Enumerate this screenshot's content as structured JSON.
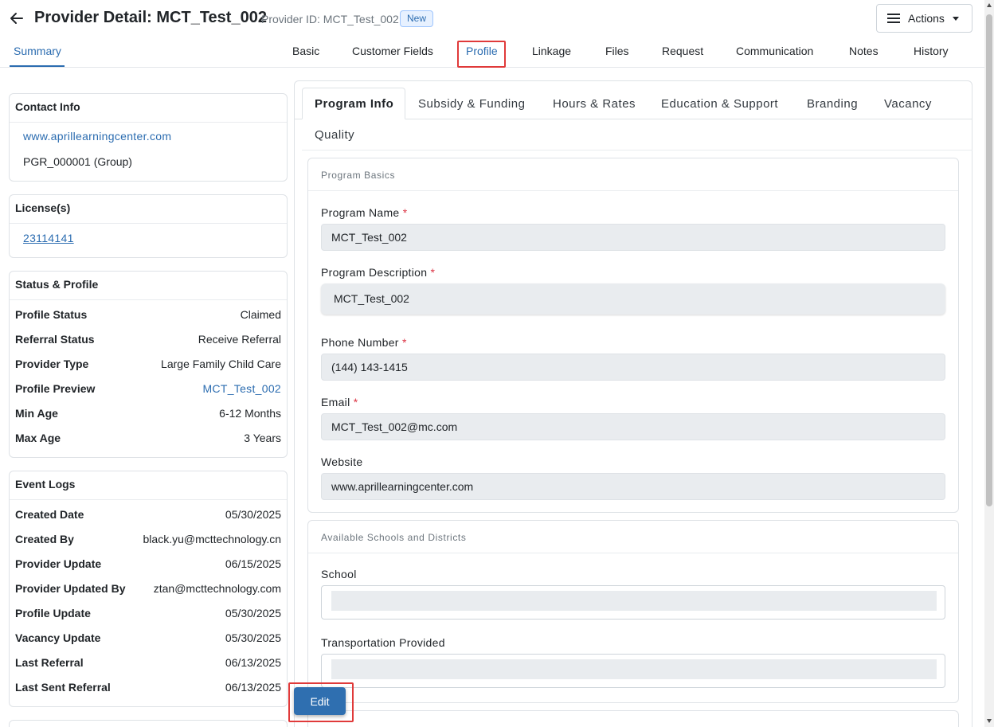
{
  "header": {
    "title": "Provider Detail: MCT_Test_002",
    "provider_id": "Provider ID: MCT_Test_002",
    "badge": "New",
    "actions_label": "Actions"
  },
  "top_tabs": {
    "summary": "Summary",
    "basic": "Basic",
    "customer_fields": "Customer Fields",
    "profile": "Profile",
    "linkage": "Linkage",
    "files": "Files",
    "request": "Request",
    "communication": "Communication",
    "notes": "Notes",
    "history": "History"
  },
  "contact_info": {
    "title": "Contact Info",
    "website": "www.aprillearningcenter.com",
    "group": "PGR_000001 (Group)"
  },
  "licenses": {
    "title": "License(s)",
    "number": "23114141"
  },
  "status_profile": {
    "title": "Status & Profile",
    "rows": [
      {
        "label": "Profile Status",
        "value": "Claimed"
      },
      {
        "label": "Referral Status",
        "value": "Receive Referral"
      },
      {
        "label": "Provider Type",
        "value": "Large Family Child Care"
      },
      {
        "label": "Profile Preview",
        "value": "MCT_Test_002"
      },
      {
        "label": "Min Age",
        "value": "6-12 Months"
      },
      {
        "label": "Max Age",
        "value": "3 Years"
      }
    ]
  },
  "event_logs": {
    "title": "Event Logs",
    "rows": [
      {
        "label": "Created Date",
        "value": "05/30/2025"
      },
      {
        "label": "Created By",
        "value": "black.yu@mcttechnology.cn"
      },
      {
        "label": "Provider Update",
        "value": "06/15/2025"
      },
      {
        "label": "Provider Updated By",
        "value": "ztan@mcttechnology.com"
      },
      {
        "label": "Profile Update",
        "value": "05/30/2025"
      },
      {
        "label": "Vacancy Update",
        "value": "05/30/2025"
      },
      {
        "label": "Last Referral",
        "value": "06/13/2025"
      },
      {
        "label": "Last Sent Referral",
        "value": "06/13/2025"
      }
    ]
  },
  "sub_tabs": {
    "program_info": "Program Info",
    "subsidy_funding": "Subsidy & Funding",
    "hours_rates": "Hours & Rates",
    "education_support": "Education & Support",
    "branding": "Branding",
    "vacancy": "Vacancy",
    "quality": "Quality"
  },
  "program_basics": {
    "title": "Program Basics",
    "program_name_label": "Program Name",
    "program_name": "MCT_Test_002",
    "program_description_label": "Program Description",
    "program_description": "MCT_Test_002",
    "phone_label": "Phone Number",
    "phone": "(144) 143-1415",
    "email_label": "Email",
    "email": "MCT_Test_002@mc.com",
    "website_label": "Website",
    "website": "www.aprillearningcenter.com",
    "required_mark": "*"
  },
  "schools": {
    "title": "Available Schools and Districts",
    "school_label": "School",
    "transportation_label": "Transportation Provided"
  },
  "edit_label": "Edit"
}
